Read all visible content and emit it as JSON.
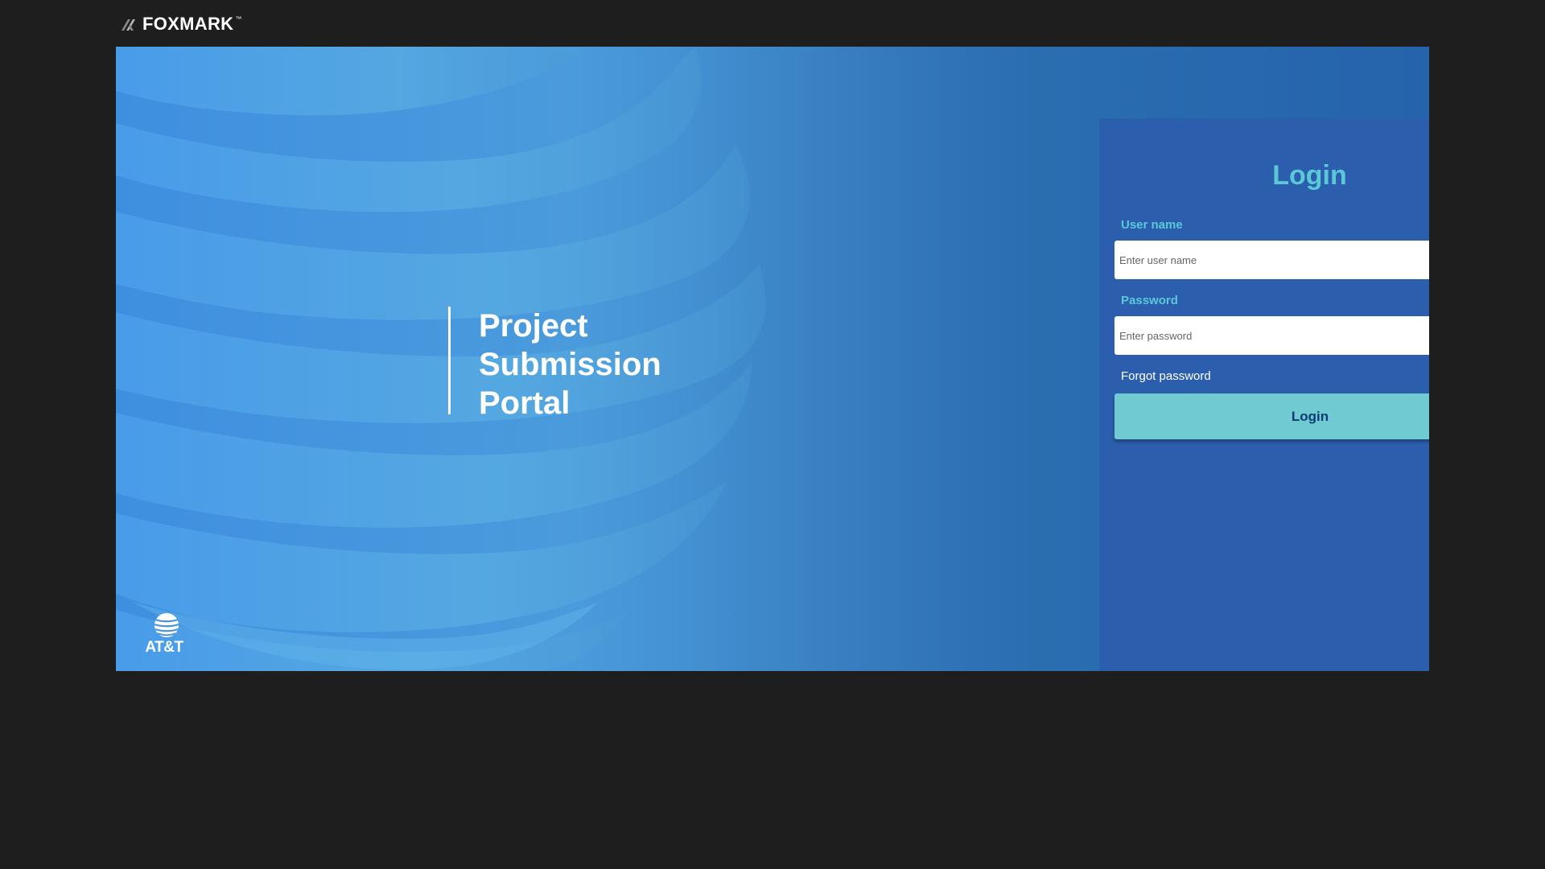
{
  "header": {
    "brand_name": "FOXMARK",
    "brand_tm": "™",
    "brand_icon": "foxmark-chevrons-icon"
  },
  "hero": {
    "tagline": [
      "Project",
      "Submission",
      "Portal"
    ],
    "partner_logo_text": "AT&T",
    "partner_logo_icon": "att-globe-icon"
  },
  "login": {
    "title": "Login",
    "username_label": "User name",
    "username_placeholder": "Enter user name",
    "username_value": "",
    "password_label": "Password",
    "password_placeholder": "Enter password",
    "password_value": "",
    "forgot_password_label": "Forgot password",
    "submit_label": "Login"
  },
  "colors": {
    "page_background": "#1e1e1e",
    "hero_gradient_start": "#3f8fe0",
    "hero_gradient_end": "#2563ac",
    "card_background": "#2b5fae",
    "accent": "#5bc8d8",
    "button_background": "#6fcbd1",
    "button_text": "#0d3b78"
  }
}
